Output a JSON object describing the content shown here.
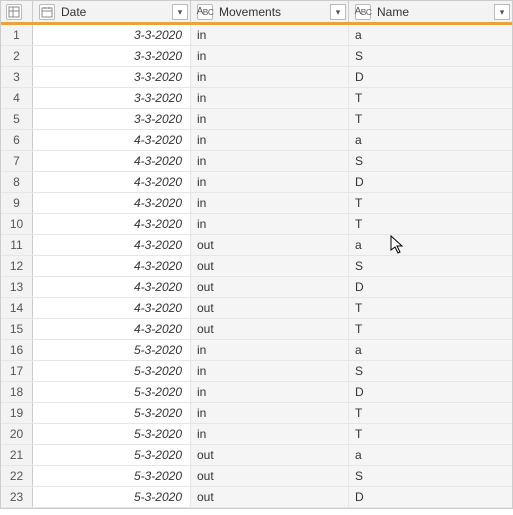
{
  "columns": {
    "date": {
      "label": "Date",
      "type_icon": "date"
    },
    "move": {
      "label": "Movements",
      "type_icon": "text"
    },
    "name": {
      "label": "Name",
      "type_icon": "text"
    }
  },
  "rows": [
    {
      "n": "1",
      "date": "3-3-2020",
      "move": "in",
      "name": "a"
    },
    {
      "n": "2",
      "date": "3-3-2020",
      "move": "in",
      "name": "S"
    },
    {
      "n": "3",
      "date": "3-3-2020",
      "move": "in",
      "name": "D"
    },
    {
      "n": "4",
      "date": "3-3-2020",
      "move": "in",
      "name": "T"
    },
    {
      "n": "5",
      "date": "3-3-2020",
      "move": "in",
      "name": "T"
    },
    {
      "n": "6",
      "date": "4-3-2020",
      "move": "in",
      "name": "a"
    },
    {
      "n": "7",
      "date": "4-3-2020",
      "move": "in",
      "name": "S"
    },
    {
      "n": "8",
      "date": "4-3-2020",
      "move": "in",
      "name": "D"
    },
    {
      "n": "9",
      "date": "4-3-2020",
      "move": "in",
      "name": "T"
    },
    {
      "n": "10",
      "date": "4-3-2020",
      "move": "in",
      "name": "T"
    },
    {
      "n": "11",
      "date": "4-3-2020",
      "move": "out",
      "name": "a"
    },
    {
      "n": "12",
      "date": "4-3-2020",
      "move": "out",
      "name": "S"
    },
    {
      "n": "13",
      "date": "4-3-2020",
      "move": "out",
      "name": "D"
    },
    {
      "n": "14",
      "date": "4-3-2020",
      "move": "out",
      "name": "T"
    },
    {
      "n": "15",
      "date": "4-3-2020",
      "move": "out",
      "name": "T"
    },
    {
      "n": "16",
      "date": "5-3-2020",
      "move": "in",
      "name": "a"
    },
    {
      "n": "17",
      "date": "5-3-2020",
      "move": "in",
      "name": "S"
    },
    {
      "n": "18",
      "date": "5-3-2020",
      "move": "in",
      "name": "D"
    },
    {
      "n": "19",
      "date": "5-3-2020",
      "move": "in",
      "name": "T"
    },
    {
      "n": "20",
      "date": "5-3-2020",
      "move": "in",
      "name": "T"
    },
    {
      "n": "21",
      "date": "5-3-2020",
      "move": "out",
      "name": "a"
    },
    {
      "n": "22",
      "date": "5-3-2020",
      "move": "out",
      "name": "S"
    },
    {
      "n": "23",
      "date": "5-3-2020",
      "move": "out",
      "name": "D"
    }
  ]
}
